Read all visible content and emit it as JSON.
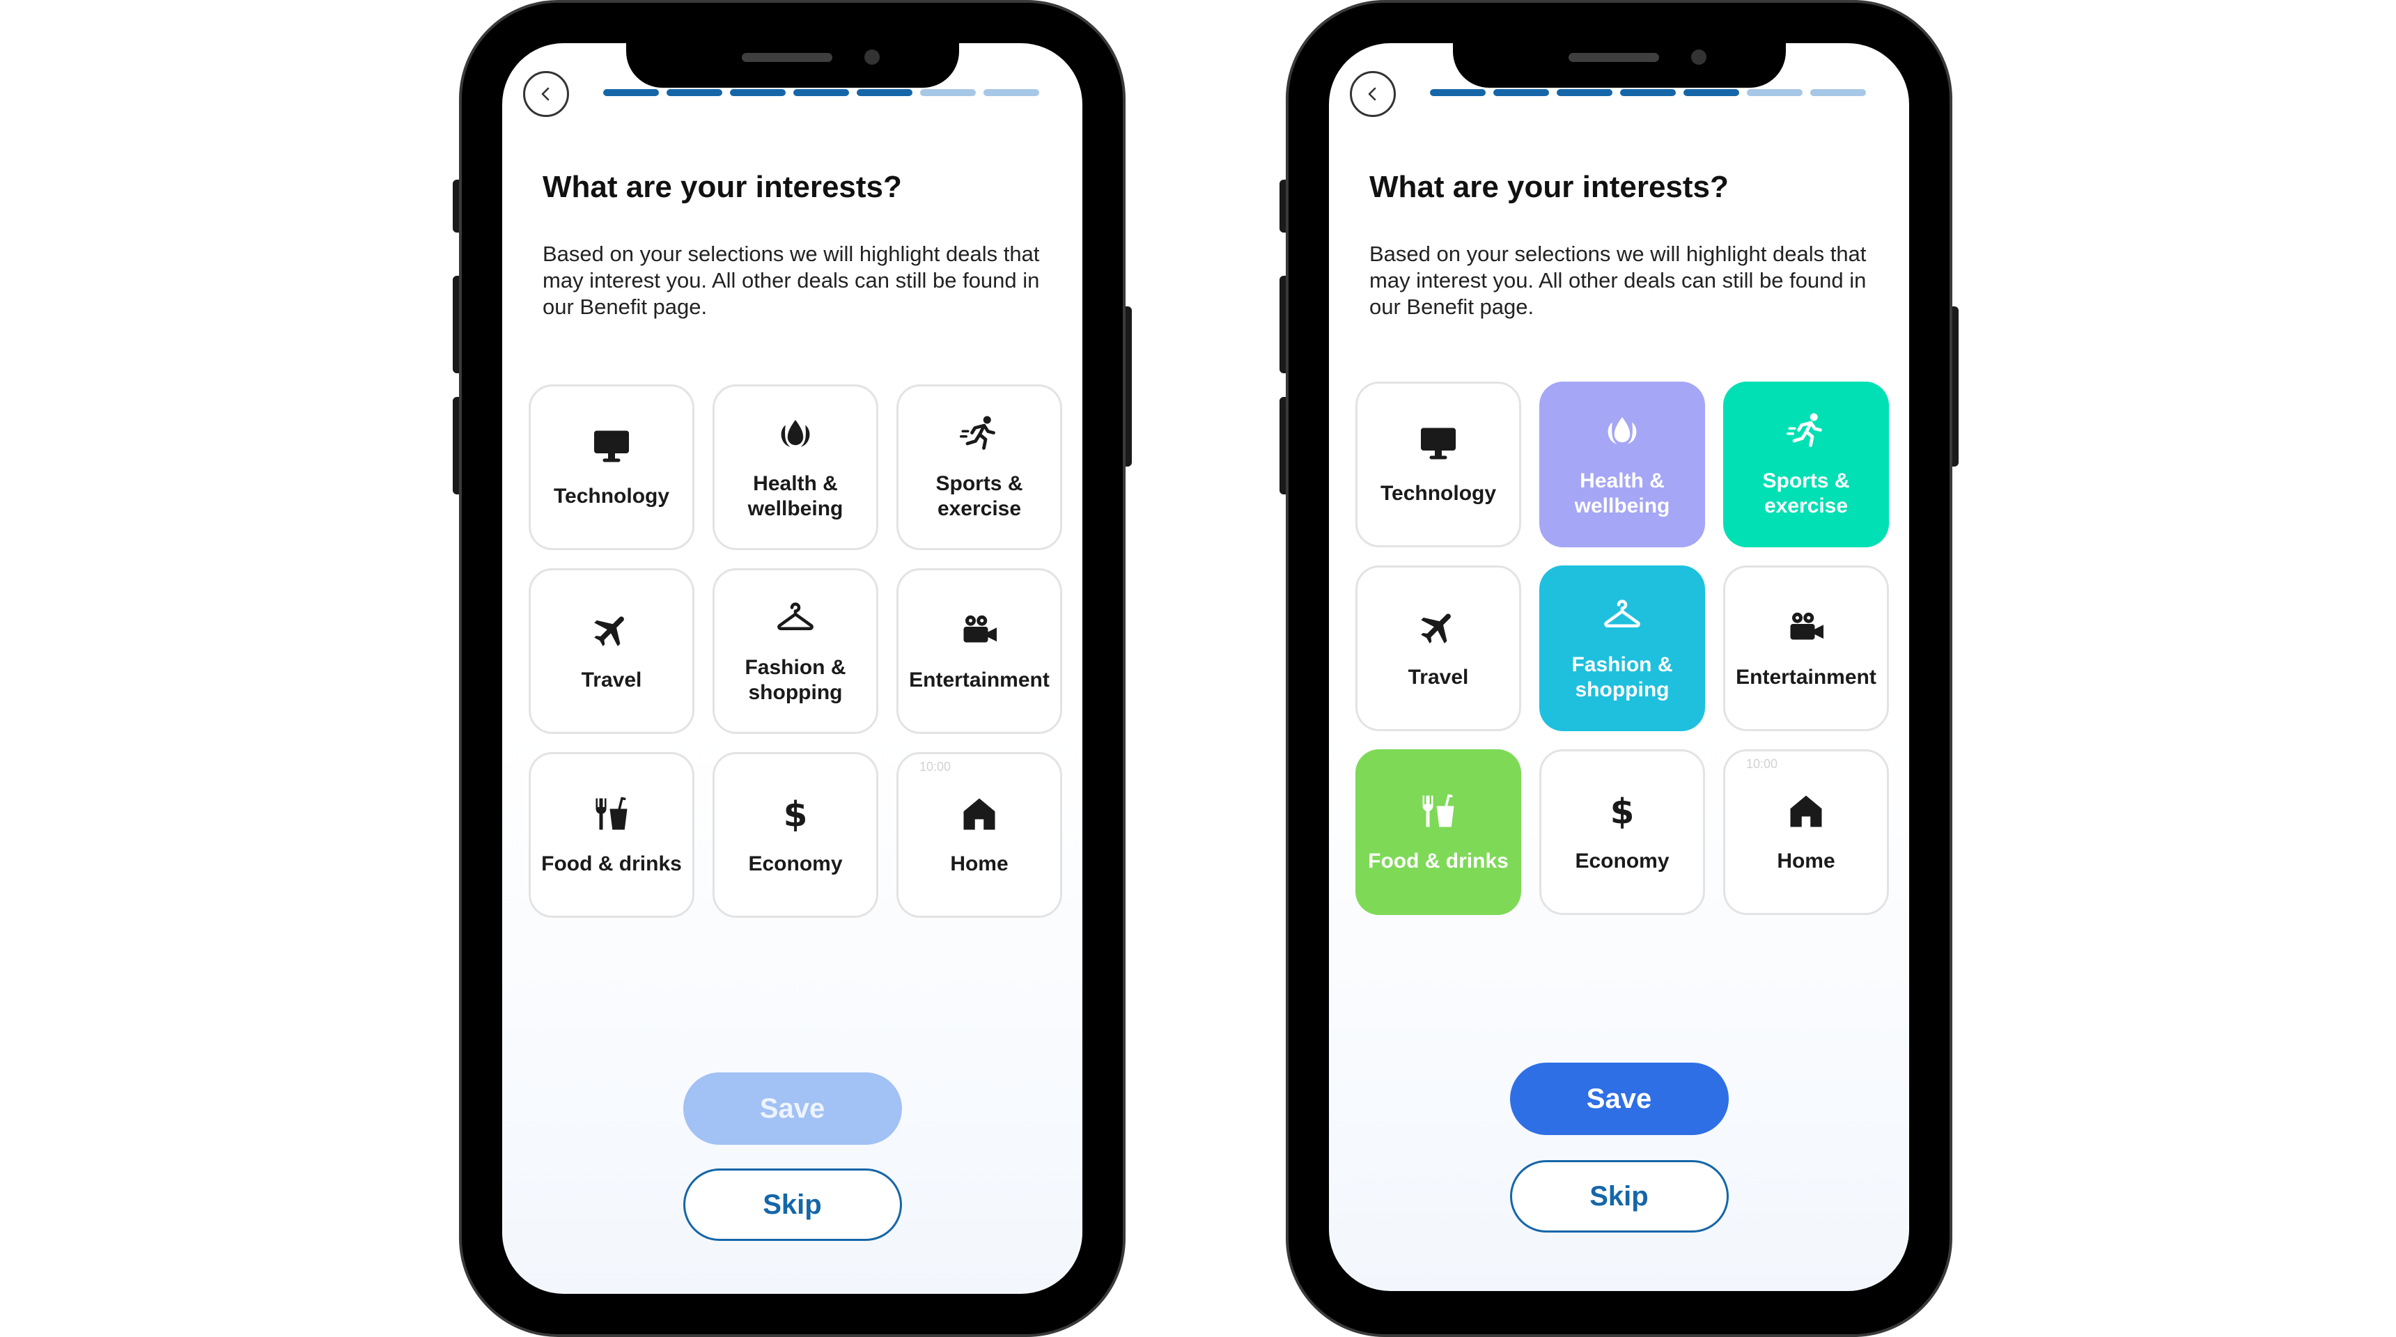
{
  "colors": {
    "progress_done": "#1566a8",
    "progress_todo": "#a7c7e7",
    "save_disabled": "#a2c1f4",
    "save_enabled": "#2f6fe5",
    "skip_border": "#1566a8",
    "health_selected": "#a5a6f6",
    "sports_selected": "#00e0b4",
    "fashion_selected": "#1ec0de",
    "food_selected": "#7ed957"
  },
  "screens": [
    {
      "title": "What are your interests?",
      "description": "Based on your selections we will highlight deals that may interest you. All other deals can still be found in our Benefit page.",
      "progress": {
        "completed": 5,
        "total": 7
      },
      "tiles": [
        {
          "label": "Technology",
          "icon": "monitor-icon",
          "selected": false
        },
        {
          "label": "Health & wellbeing",
          "icon": "lotus-drop-icon",
          "selected": false
        },
        {
          "label": "Sports & exercise",
          "icon": "running-person-icon",
          "selected": false
        },
        {
          "label": "Travel",
          "icon": "airplane-icon",
          "selected": false
        },
        {
          "label": "Fashion & shopping",
          "icon": "hanger-icon",
          "selected": false
        },
        {
          "label": "Entertainment",
          "icon": "movie-camera-icon",
          "selected": false
        },
        {
          "label": "Food & drinks",
          "icon": "cutlery-cup-icon",
          "selected": false
        },
        {
          "label": "Economy",
          "icon": "dollar-icon",
          "selected": false
        },
        {
          "label": "Home",
          "icon": "house-icon",
          "selected": false,
          "faint_text": "10:00"
        }
      ],
      "save_label": "Save",
      "save_state": "disabled",
      "skip_label": "Skip"
    },
    {
      "title": "What are your interests?",
      "description": "Based on your selections we will highlight deals that may interest you. All other deals can still be found in our Benefit page.",
      "progress": {
        "completed": 5,
        "total": 7
      },
      "tiles": [
        {
          "label": "Technology",
          "icon": "monitor-icon",
          "selected": false
        },
        {
          "label": "Health & wellbeing",
          "icon": "lotus-drop-icon",
          "selected": true,
          "color": "#a5a6f6"
        },
        {
          "label": "Sports & exercise",
          "icon": "running-person-icon",
          "selected": true,
          "color": "#00e0b4"
        },
        {
          "label": "Travel",
          "icon": "airplane-icon",
          "selected": false
        },
        {
          "label": "Fashion & shopping",
          "icon": "hanger-icon",
          "selected": true,
          "color": "#1ec0de"
        },
        {
          "label": "Entertainment",
          "icon": "movie-camera-icon",
          "selected": false
        },
        {
          "label": "Food & drinks",
          "icon": "cutlery-cup-icon",
          "selected": true,
          "color": "#7ed957"
        },
        {
          "label": "Economy",
          "icon": "dollar-icon",
          "selected": false
        },
        {
          "label": "Home",
          "icon": "house-icon",
          "selected": false,
          "faint_text": "10:00"
        }
      ],
      "save_label": "Save",
      "save_state": "enabled",
      "skip_label": "Skip"
    }
  ]
}
